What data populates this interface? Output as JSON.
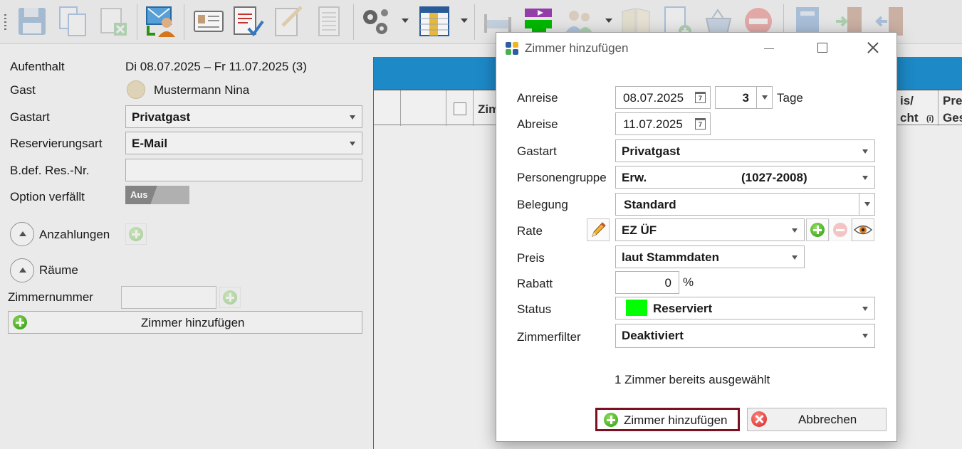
{
  "toolbar": {
    "icons": [
      "save-icon",
      "copy-icon",
      "delete-copy-icon",
      "guest-transfer-icon",
      "guest-card-icon",
      "registration-form-icon",
      "checklist-icon",
      "table-icon",
      "gears-icon",
      "column-layout-icon",
      "bed-icon",
      "room-move-icon",
      "persons-icon",
      "book-icon",
      "add-document-icon",
      "basket-icon",
      "no-entry-icon",
      "folder-icon",
      "checkin-door-icon",
      "checkout-door-icon"
    ]
  },
  "left": {
    "aufenthalt_label": "Aufenthalt",
    "aufenthalt_value": "Di 08.07.2025 – Fr 11.07.2025 (3)",
    "gast_label": "Gast",
    "gast_value": "Mustermann Nina",
    "gastart_label": "Gastart",
    "gastart_value": "Privatgast",
    "reservierungsart_label": "Reservierungsart",
    "reservierungsart_value": "E-Mail",
    "bdef_label": "B.def. Res.-Nr.",
    "bdef_value": "",
    "option_label": "Option verfällt",
    "option_toggle": "Aus",
    "anzahlungen_label": "Anzahlungen",
    "raeume_label": "Räume",
    "zimmernummer_label": "Zimmernummer",
    "zimmernummer_value": "",
    "add_room_label": "Zimmer hinzufügen"
  },
  "grid": {
    "col_partial": "Zim",
    "col_preis_line1": "is/",
    "col_preis_line2": "cht",
    "col_preis_info": "(i)",
    "col_pre_line1": "Pre",
    "col_pre_line2": "Ges"
  },
  "dialog": {
    "title": "Zimmer hinzufügen",
    "anreise_label": "Anreise",
    "anreise_value": "08.07.2025",
    "nights_value": "3",
    "tage_label": "Tage",
    "abreise_label": "Abreise",
    "abreise_value": "11.07.2025",
    "calendar_day": "7",
    "gastart_label": "Gastart",
    "gastart_value": "Privatgast",
    "personengruppe_label": "Personengruppe",
    "personengruppe_value": "Erw.",
    "personengruppe_code": "(1027-2008)",
    "belegung_label": "Belegung",
    "belegung_value": "Standard",
    "rate_label": "Rate",
    "rate_value": "EZ ÜF",
    "preis_label": "Preis",
    "preis_value": "laut Stammdaten",
    "rabatt_label": "Rabatt",
    "rabatt_value": "0",
    "rabatt_unit": "%",
    "status_label": "Status",
    "status_value": "Reserviert",
    "status_color": "#00ff00",
    "zimmerfilter_label": "Zimmerfilter",
    "zimmerfilter_value": "Deaktiviert",
    "info_text": "1 Zimmer bereits ausgewählt",
    "add_button": "Zimmer hinzufügen",
    "cancel_button": "Abbrechen"
  },
  "colors": {
    "grid_header_blue": "#1f8fd0",
    "primary_button_border": "#7a1020"
  }
}
